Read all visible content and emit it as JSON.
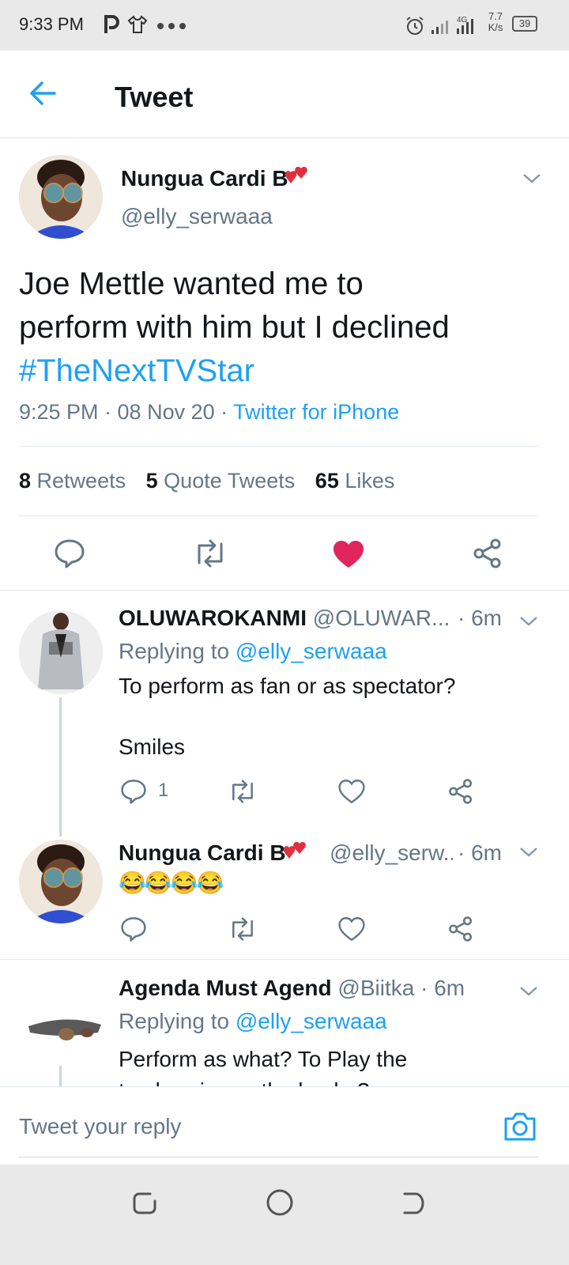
{
  "status_bar": {
    "time": "9:33 PM",
    "network": "4G",
    "speed": "7.7 K/s",
    "battery": "39"
  },
  "header": {
    "title": "Tweet"
  },
  "tweet": {
    "author_name": "Nungua Cardi B",
    "author_handle": "@elly_serwaaa",
    "text_line1": "Joe Mettle wanted me to",
    "text_line2": "perform with him but I declined",
    "hashtag": "#TheNextTVStar",
    "time": "9:25 PM · 08 Nov 20 ·",
    "source": "Twitter for iPhone",
    "retweets_count": "8",
    "retweets_label": "Retweets",
    "quotes_count": "5",
    "quotes_label": "Quote Tweets",
    "likes_count": "65",
    "likes_label": "Likes"
  },
  "replies": [
    {
      "author_name": "OLUWAROKANMI",
      "author_handle": "@OLUWAR...",
      "time": "· 6m",
      "replying_prefix": "Replying to",
      "replying_handle": "@elly_serwaaa",
      "text_line1": "To perform as fan or as spectator?",
      "text_line2": "Smiles",
      "reply_count": "1"
    },
    {
      "author_name": "Nungua Cardi B",
      "author_handle": "@elly_serw...",
      "time": "· 6m",
      "text": "😂😂😂😂"
    },
    {
      "author_name": "Agenda Must Agend",
      "author_handle": "@Biitka",
      "time": "· 6m",
      "replying_prefix": "Replying to",
      "replying_handle": "@elly_serwaaa",
      "text_line1": "Perform as what?  To Play the",
      "text_line2": "tambourine or the konka?"
    }
  ],
  "composer": {
    "placeholder": "Tweet your reply"
  },
  "colors": {
    "accent": "#1da1f2",
    "like": "#e0245e",
    "muted": "#657786"
  }
}
